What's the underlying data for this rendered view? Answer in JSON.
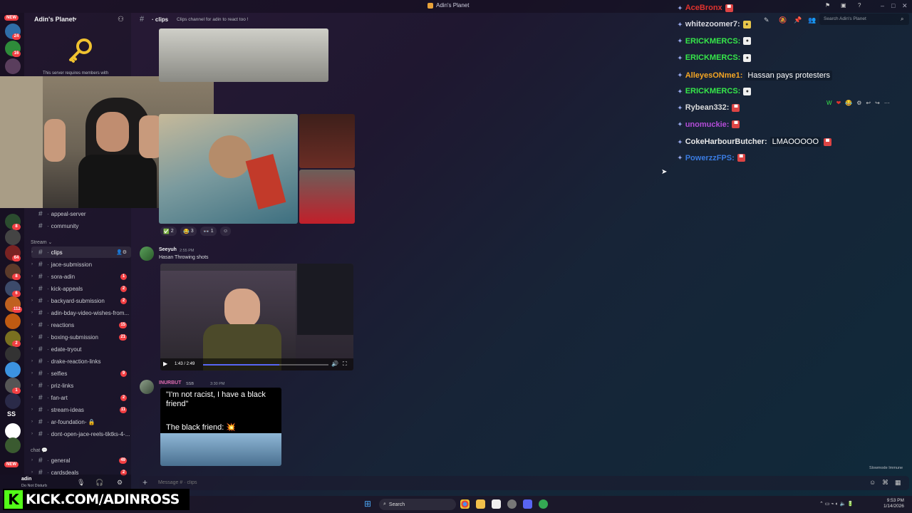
{
  "window": {
    "title": "Adin's Planet",
    "controls": [
      "–",
      "□",
      "✕"
    ]
  },
  "rail": {
    "new_badge": "NEW",
    "bottom_new_badge": "NEW",
    "servers": [
      {
        "badge": "24",
        "color": "#2f6ea8"
      },
      {
        "badge": "16",
        "color": "#2e8b3a"
      },
      {
        "badge": "",
        "color": "#5a3e5d"
      },
      {
        "badge": "8",
        "color": "#2b4c2f"
      },
      {
        "badge": "",
        "color": "#444"
      },
      {
        "badge": "64",
        "color": "#7a2222"
      },
      {
        "badge": "8",
        "color": "#5b3a2a"
      },
      {
        "badge": "6",
        "color": "#3c4a6a"
      },
      {
        "badge": "112",
        "color": "#c06020"
      },
      {
        "badge": "",
        "color": "#c05a12"
      },
      {
        "badge": "2",
        "color": "#7a7020"
      },
      {
        "badge": "",
        "color": "#333"
      },
      {
        "badge": "",
        "color": "#3c93e0"
      },
      {
        "badge": "1",
        "color": "#555"
      },
      {
        "badge": "",
        "color": "#2a2a48"
      },
      {
        "badge": "",
        "color": "#fff"
      },
      {
        "badge": "",
        "color": "#3a5a30"
      }
    ],
    "server_initials": "SS",
    "server_initials_badge": "1"
  },
  "sidebar": {
    "server_name": "Adin's Planet",
    "requirement_text": "This server requires members with",
    "channels_top": [
      {
        "name": "appeal-server",
        "badge": ""
      },
      {
        "name": "community",
        "badge": ""
      }
    ],
    "category_stream": "Stream",
    "stream_channels": [
      {
        "name": "clips",
        "badge": "",
        "selected": true
      },
      {
        "name": "jace-submission",
        "badge": ""
      },
      {
        "name": "sora-adin",
        "badge": "1"
      },
      {
        "name": "kick-appeals",
        "badge": "2"
      },
      {
        "name": "backyard-submission",
        "badge": "2"
      },
      {
        "name": "adin-bday-video-wishes-from...",
        "badge": ""
      },
      {
        "name": "reactions",
        "badge": "15"
      },
      {
        "name": "boxing-submission",
        "badge": "21"
      },
      {
        "name": "edate-tryout",
        "badge": ""
      },
      {
        "name": "drake-reaction-links",
        "badge": ""
      },
      {
        "name": "selfies",
        "badge": "9"
      },
      {
        "name": "priz-links",
        "badge": ""
      },
      {
        "name": "fan-art",
        "badge": "2"
      },
      {
        "name": "stream-ideas",
        "badge": "11"
      },
      {
        "name": "ar-foundation- 🔒",
        "badge": ""
      },
      {
        "name": "dont-open-jace-reels-tiktks-4-...",
        "badge": ""
      }
    ],
    "category_chat": "chat",
    "chat_channels": [
      {
        "name": "general",
        "badge": "49"
      },
      {
        "name": "cardsdeals",
        "badge": "2"
      }
    ]
  },
  "header": {
    "channel": "clips",
    "topic": "Clips channel for adin to react too !",
    "search_placeholder": "Search Adin's Planet"
  },
  "messages": {
    "reactions": [
      {
        "emoji": "✅",
        "count": "2"
      },
      {
        "emoji": "😂",
        "count": "3"
      },
      {
        "emoji": "👓",
        "count": "1"
      },
      {
        "emoji": "☺",
        "count": ""
      }
    ],
    "msg1": {
      "author": "Seeyuh",
      "time": "2:55 PM",
      "text": "Hasan Throwing shots",
      "video_time": "1:43 / 2:49",
      "video_progress": 0.61
    },
    "msg2": {
      "author": "INURBUT",
      "tag": "SSB",
      "time": "3:30 PM",
      "caption_line1": "\"I'm not racist, I have a black",
      "caption_line2": "friend\"",
      "caption_line3": "The black friend: 💥"
    }
  },
  "message_actions": [
    "W",
    "❤",
    "😂",
    "⚙",
    "↩",
    "↪",
    "⋯"
  ],
  "overlay_chat": [
    {
      "user": "AceBronx",
      "color": "#e0332e",
      "text": "",
      "emote": "red"
    },
    {
      "user": "whitezoomer7:",
      "color": "#d8d8e0",
      "text": "",
      "emote": "gold"
    },
    {
      "user": "ERICKMERCS:",
      "color": "#36e84a",
      "text": "",
      "emote": "white"
    },
    {
      "user": "ERICKMERCS:",
      "color": "#36e84a",
      "text": "",
      "emote": "white"
    },
    {
      "user": "AlleyesONme1:",
      "color": "#f5a623",
      "text": "Hassan pays protesters",
      "emote": ""
    },
    {
      "user": "ERICKMERCS:",
      "color": "#36e84a",
      "text": "",
      "emote": "white"
    },
    {
      "user": "Rybean332:",
      "color": "#dcdcdc",
      "text": "",
      "emote": "red"
    },
    {
      "user": "unomuckie:",
      "color": "#b44cd8",
      "text": "",
      "emote": "red"
    },
    {
      "user": "CokeHarbourButcher:",
      "color": "#e8e8e8",
      "text": "LMAOOOOO",
      "emote": "red"
    },
    {
      "user": "PowerzzFPS:",
      "color": "#3a7be0",
      "text": "",
      "emote": "red"
    }
  ],
  "composer": {
    "placeholder": "Message # · clips"
  },
  "user_panel": {
    "name": "adin",
    "status": "Do Not Disturb"
  },
  "kick_banner": {
    "k": "K",
    "text": "KICK.COM/ADINROSS"
  },
  "slowmode": "Slowmode Immune",
  "taskbar": {
    "search": "Search",
    "time": "9:53 PM",
    "date": "1/14/2026"
  }
}
